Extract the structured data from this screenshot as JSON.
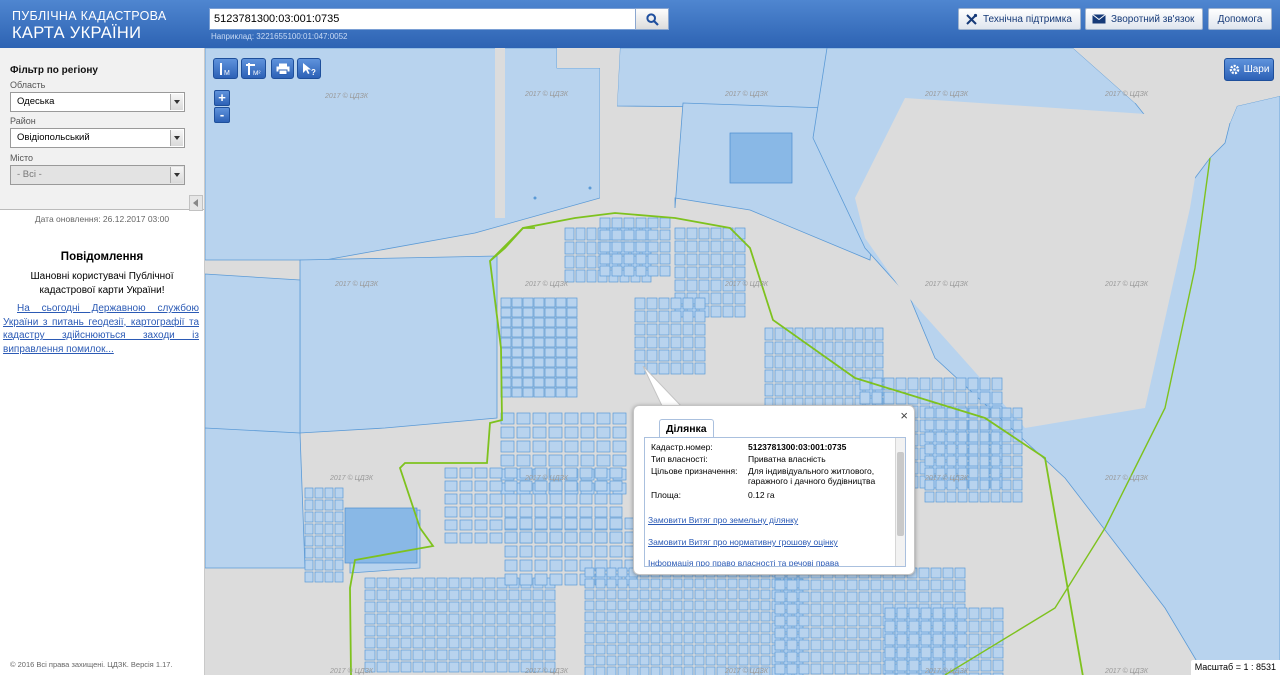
{
  "header": {
    "logo_line1": "ПУБЛІЧНА КАДАСТРОВА",
    "logo_line2": "КАРТА УКРАЇНИ",
    "search_value": "5123781300:03:001:0735",
    "search_hint": "Наприклад: 3221655100:01:047:0052",
    "buttons": {
      "support": "Технічна підтримка",
      "feedback": "Зворотний зв'язок",
      "help": "Допомога"
    }
  },
  "sidebar": {
    "filter_title": "Фільтр по регіону",
    "oblast_label": "Область",
    "oblast_value": "Одеська",
    "rayon_label": "Район",
    "rayon_value": "Овідіопольський",
    "misto_label": "Місто",
    "misto_value": "- Всі -",
    "update_date": "Дата оновлення: 26.12.2017 03:00",
    "news_title": "Повідомлення",
    "news_text": "Шановні користувачі Публічної кадастрової карти України!",
    "news_link": "На сьогодні Державною службою України з питань геодезії, картографії та кадастру здійснюються заходи із виправлення помилок...",
    "copyright": "© 2016 Всі права захищені. ЦДЗК. Версія 1.17."
  },
  "map": {
    "tools": {
      "measure_line": "М",
      "measure_area": "М²"
    },
    "zoom_in": "+",
    "zoom_out": "-",
    "layers_label": "Шари",
    "scale_text": "Масштаб = 1 : 8531",
    "watermark": "2017 © ЦДЗК"
  },
  "popup": {
    "tab_title": "Ділянка",
    "close_symbol": "×",
    "rows": [
      {
        "label": "Кадастр.номер:",
        "value": "5123781300:03:001:0735"
      },
      {
        "label": "Тип власності:",
        "value": "Приватна власність"
      },
      {
        "label": "Цільове призначення:",
        "value": "Для індивідуального житлового, гаражного і дачного будівництва"
      },
      {
        "label": "Площа:",
        "value": "0.12 га"
      }
    ],
    "links": [
      "Замовити Витяг про земельну ділянку",
      "Замовити Витяг про нормативну грошову оцінку",
      "Інформація про право власності та речові права"
    ]
  },
  "colors": {
    "header_top": "#4f86d0",
    "header_bottom": "#2d63b3",
    "parcel_fill": "#b8d3ee",
    "parcel_stroke": "#5b9ad6",
    "boundary_green": "#7ec21e",
    "link_blue": "#2b5ab5"
  },
  "icons": {
    "search": "search-icon",
    "support": "tools-icon",
    "feedback": "envelope-icon",
    "layers": "gear-icon",
    "print": "printer-icon",
    "identify": "cursor-question-icon"
  }
}
